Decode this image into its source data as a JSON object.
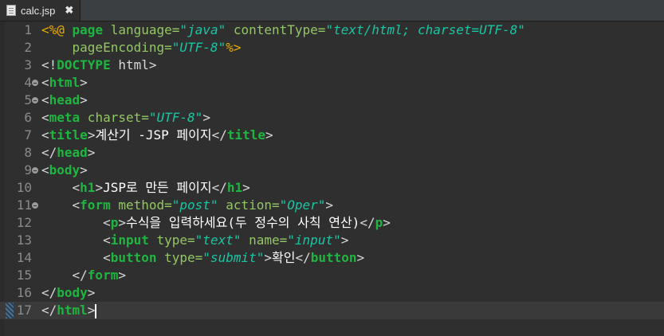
{
  "tab": {
    "title": "calc.jsp",
    "close": "✖"
  },
  "editor": {
    "line_numbers": [
      "1",
      "2",
      "3",
      "4",
      "5",
      "6",
      "7",
      "8",
      "9",
      "10",
      "11",
      "12",
      "13",
      "14",
      "15",
      "16",
      "17"
    ],
    "code": {
      "l1": {
        "open": "<%@",
        "page": " page ",
        "attr1": "language=",
        "val1": "\"java\"",
        "attr2": " contentType=",
        "val2": "\"text/html; charset=UTF-8\""
      },
      "l2": {
        "attr": "    pageEncoding=",
        "val": "\"UTF-8\"",
        "close": "%>"
      },
      "l3": {
        "open": "<!",
        "kw": "DOCTYPE",
        "rest": " html",
        "close": ">"
      },
      "l4": {
        "lt": "<",
        "tag": "html",
        "gt": ">"
      },
      "l5": {
        "lt": "<",
        "tag": "head",
        "gt": ">"
      },
      "l6": {
        "lt": "<",
        "tag": "meta",
        "attr": " charset=",
        "val": "\"UTF-8\"",
        "gt": ">"
      },
      "l7": {
        "lt": "<",
        "tag": "title",
        "gt": ">",
        "text": "계산기 -JSP 페이지",
        "lt2": "</",
        "tag2": "title",
        "gt2": ">"
      },
      "l8": {
        "lt": "</",
        "tag": "head",
        "gt": ">"
      },
      "l9": {
        "lt": "<",
        "tag": "body",
        "gt": ">"
      },
      "l10": {
        "indent": "    ",
        "lt": "<",
        "tag": "h1",
        "gt": ">",
        "text": "JSP로 만든 페이지",
        "lt2": "</",
        "tag2": "h1",
        "gt2": ">"
      },
      "l11": {
        "indent": "    ",
        "lt": "<",
        "tag": "form",
        "attr1": " method=",
        "val1": "\"post\"",
        "attr2": " action=",
        "val2": "\"Oper\"",
        "gt": ">"
      },
      "l12": {
        "indent": "        ",
        "lt": "<",
        "tag": "p",
        "gt": ">",
        "text": "수식을 입력하세요(두 정수의 사칙 연산)",
        "lt2": "</",
        "tag2": "p",
        "gt2": ">"
      },
      "l13": {
        "indent": "        ",
        "lt": "<",
        "tag": "input",
        "attr1": " type=",
        "val1": "\"text\"",
        "attr2": " name=",
        "val2": "\"input\"",
        "gt": ">"
      },
      "l14": {
        "indent": "        ",
        "lt": "<",
        "tag": "button",
        "attr1": " type=",
        "val1": "\"submit\"",
        "gt": ">",
        "text": "확인",
        "lt2": "</",
        "tag2": "button",
        "gt2": ">"
      },
      "l15": {
        "indent": "    ",
        "lt": "</",
        "tag": "form",
        "gt": ">"
      },
      "l16": {
        "lt": "</",
        "tag": "body",
        "gt": ">"
      },
      "l17": {
        "lt": "</",
        "tag": "html",
        "gt": ">"
      }
    }
  }
}
